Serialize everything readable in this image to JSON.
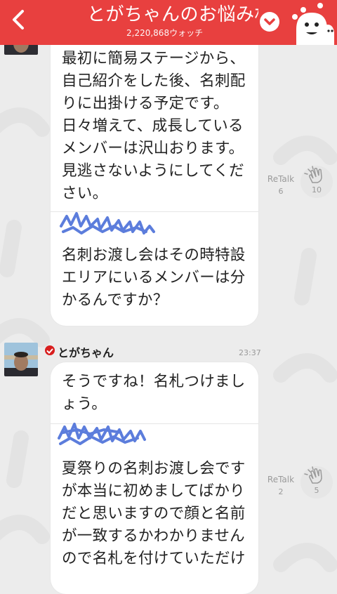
{
  "header": {
    "title": "とがちゃんのお悩み相",
    "watch_count": "2,220,868ウォッチ"
  },
  "colors": {
    "header_red": "#e8403f",
    "background": "#ececec",
    "bubble": "#ffffff",
    "scribble_blue": "#4a6fd8",
    "verified_red": "#d81e1e"
  },
  "messages": [
    {
      "lines": [
        "最初に簡易ステージから、",
        "自己紹介をした後、名刺配",
        "りに出掛ける予定です。",
        "日々増えて、成長している",
        "メンバーは沢山おります。",
        "見逃さないようにしてくだ",
        "さい。"
      ],
      "quote_lines": [
        "名刺お渡し会はその時特設",
        "エリアにいるメンバーは分",
        "かるんですか？"
      ],
      "retalk_label": "ReTalk",
      "retalk_count": "6",
      "clap_count": "10"
    },
    {
      "username": "とがちゃん",
      "time": "23:37",
      "lines": [
        "そうですね！名札つけまし",
        "ょう。"
      ],
      "quote_lines": [
        "夏祭りの名刺お渡し会です",
        "が本当に初めましてばかり",
        "だと思いますので顔と名前",
        "が一致するかわかりません",
        "ので名札を付けていただけ"
      ],
      "retalk_label": "ReTalk",
      "retalk_count": "2",
      "clap_count": "5"
    }
  ],
  "icons": [
    "back-arrow-icon",
    "chevron-down-icon",
    "mascot-icon",
    "clap-hands-icon",
    "verified-check-icon"
  ]
}
